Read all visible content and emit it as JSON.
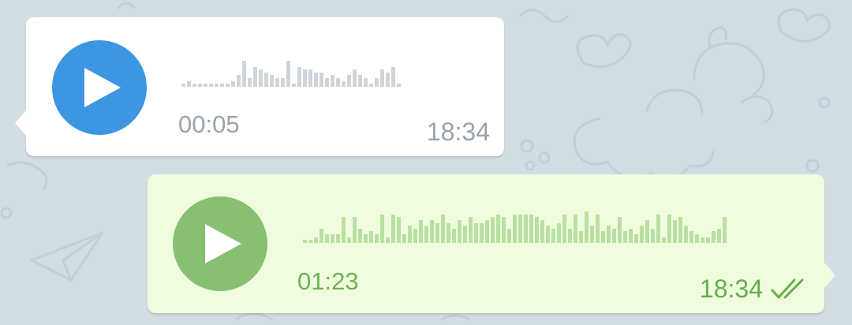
{
  "colors": {
    "background": "#d3dde4",
    "incoming_bubble": "#ffffff",
    "outgoing_bubble": "#effdde",
    "incoming_play": "#3d96e2",
    "outgoing_play": "#87c072",
    "incoming_meta": "#9aa3aa",
    "outgoing_meta": "#67ad4c"
  },
  "messages": [
    {
      "direction": "incoming",
      "play_icon": "play-icon",
      "duration": "00:05",
      "time": "18:34",
      "waveform": [
        1,
        2,
        1,
        1,
        1,
        1,
        1,
        1,
        1,
        2,
        4,
        9,
        3,
        7,
        6,
        5,
        4,
        3,
        3,
        9,
        1,
        7,
        6,
        6,
        5,
        5,
        3,
        4,
        3,
        2,
        4,
        6,
        4,
        3,
        1,
        3,
        6,
        5,
        7,
        1
      ]
    },
    {
      "direction": "outgoing",
      "play_icon": "play-icon",
      "duration": "01:23",
      "time": "18:34",
      "status_icon": "double-check-icon",
      "waveform": [
        1,
        1,
        2,
        5,
        3,
        3,
        3,
        9,
        2,
        9,
        5,
        3,
        4,
        3,
        10,
        2,
        10,
        9,
        3,
        6,
        5,
        8,
        6,
        8,
        7,
        10,
        7,
        5,
        8,
        6,
        9,
        7,
        7,
        8,
        9,
        10,
        9,
        5,
        10,
        10,
        10,
        10,
        9,
        8,
        6,
        5,
        7,
        10,
        5,
        10,
        4,
        11,
        6,
        10,
        4,
        6,
        5,
        9,
        4,
        5,
        3,
        6,
        8,
        5,
        10,
        2,
        10,
        8,
        9,
        6,
        4,
        3,
        2,
        2,
        4,
        5,
        9
      ]
    }
  ]
}
